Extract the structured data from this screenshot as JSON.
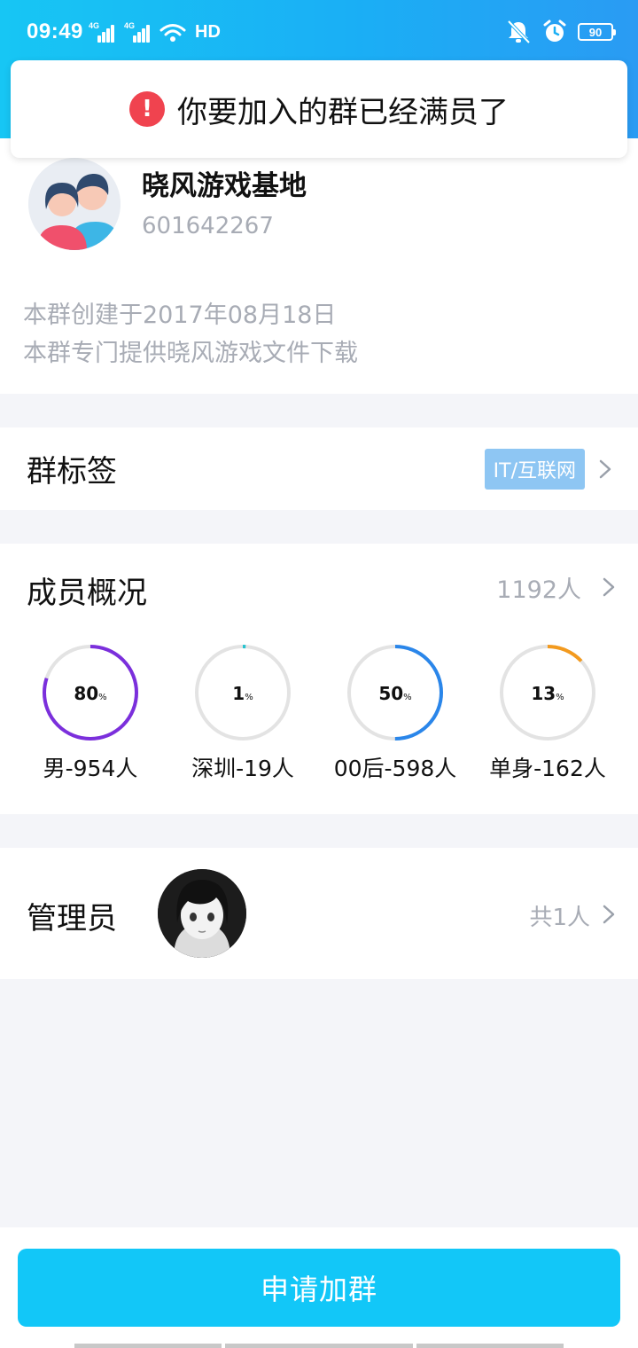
{
  "status_bar": {
    "time": "09:49",
    "signal1_label": "4G",
    "signal2_label": "4G",
    "hd_label": "HD",
    "battery": "90"
  },
  "toast": {
    "icon": "!",
    "message": "你要加入的群已经满员了",
    "icon_color": "#f0434f"
  },
  "group": {
    "name": "晓风游戏基地",
    "id": "601642267",
    "created": "本群创建于2017年08月18日",
    "description": "本群专门提供晓风游戏文件下载"
  },
  "tags": {
    "title": "群标签",
    "tag": "IT/互联网"
  },
  "members": {
    "title": "成员概况",
    "count": "1192人",
    "stats": [
      {
        "percent": 80,
        "unit": "%",
        "label": "男-954人",
        "color": "#7b2fdc"
      },
      {
        "percent": 1,
        "unit": "%",
        "label": "深圳-19人",
        "color": "#27c3cf"
      },
      {
        "percent": 50,
        "unit": "%",
        "label": "00后-598人",
        "color": "#2a86ea"
      },
      {
        "percent": 13,
        "unit": "%",
        "label": "单身-162人",
        "color": "#f39a1e"
      }
    ]
  },
  "admins": {
    "title": "管理员",
    "count": "共1人"
  },
  "actions": {
    "apply_label": "申请加群",
    "button_color": "#12c7f8"
  },
  "icons": [
    "signal-icon",
    "wifi-icon",
    "mute-icon",
    "alarm-icon",
    "battery-icon",
    "alert-icon",
    "chevron-right-icon",
    "group-avatar-icon",
    "admin-avatar"
  ]
}
